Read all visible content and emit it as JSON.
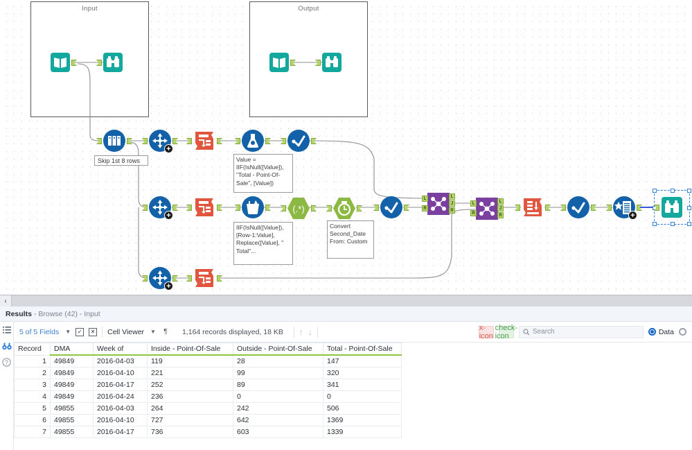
{
  "canvas": {
    "containers": [
      {
        "title": "Input"
      },
      {
        "title": "Output"
      }
    ],
    "annotations": [
      {
        "id": "skip",
        "text": "Skip 1st 8 rows"
      },
      {
        "id": "formula1",
        "text": "Value = IIF(IsNull([Value]), \"Total - Point-Of-Sale\", [Value])"
      },
      {
        "id": "multirow",
        "text": "IIF(IsNull([Value]), [Row-1:Value], Replace([Value], \" Total\"..."
      },
      {
        "id": "datetime",
        "text": "Convert Second_Date From: Custom"
      }
    ],
    "tools": [
      {
        "id": "input-1",
        "name": "input-data-tool",
        "icon": "book-icon",
        "color": "#13a89e"
      },
      {
        "id": "browse-1",
        "name": "browse-tool",
        "icon": "binoculars-icon",
        "color": "#13a89e"
      },
      {
        "id": "input-2",
        "name": "input-data-tool",
        "icon": "book-icon",
        "color": "#13a89e"
      },
      {
        "id": "browse-2",
        "name": "browse-tool",
        "icon": "binoculars-icon",
        "color": "#13a89e"
      },
      {
        "id": "sample-1",
        "name": "sample-tool",
        "icon": "sample-bars-icon",
        "color": "#1261a9"
      },
      {
        "id": "select-1",
        "name": "select-tool",
        "icon": "move-arrows-icon",
        "color": "#1261a9"
      },
      {
        "id": "transpose-1",
        "name": "transpose-tool",
        "icon": "transpose-icon",
        "color": "#e0563f"
      },
      {
        "id": "formula-1",
        "name": "formula-tool",
        "icon": "flask-icon",
        "color": "#1261a9"
      },
      {
        "id": "filter-1",
        "name": "filter-tool",
        "icon": "check-line-icon",
        "color": "#1261a9"
      },
      {
        "id": "select-2",
        "name": "select-tool",
        "icon": "move-arrows-icon",
        "color": "#1261a9"
      },
      {
        "id": "transpose-2",
        "name": "transpose-tool",
        "icon": "transpose-icon",
        "color": "#e0563f"
      },
      {
        "id": "multirow-1",
        "name": "multi-row-formula-tool",
        "icon": "bucket-icon",
        "color": "#1261a9"
      },
      {
        "id": "regex-1",
        "name": "regex-tool",
        "icon": "regex-icon",
        "color": "#8cb943"
      },
      {
        "id": "datetime-1",
        "name": "datetime-tool",
        "icon": "clock-icon",
        "color": "#8cb943"
      },
      {
        "id": "filter-2",
        "name": "filter-tool",
        "icon": "check-line-icon",
        "color": "#1261a9"
      },
      {
        "id": "select-3",
        "name": "select-tool",
        "icon": "move-arrows-icon",
        "color": "#1261a9"
      },
      {
        "id": "transpose-3",
        "name": "transpose-tool",
        "icon": "transpose-icon",
        "color": "#e0563f"
      },
      {
        "id": "join-1",
        "name": "join-tool",
        "icon": "join-icon",
        "color": "#7b3fa0"
      },
      {
        "id": "join-2",
        "name": "join-tool",
        "icon": "join-icon",
        "color": "#7b3fa0"
      },
      {
        "id": "crosstab-1",
        "name": "crosstab-tool",
        "icon": "crosstab-icon",
        "color": "#e0563f"
      },
      {
        "id": "filter-3",
        "name": "filter-tool",
        "icon": "check-line-icon",
        "color": "#1261a9"
      },
      {
        "id": "summarize-1",
        "name": "summarize-tool",
        "icon": "summarize-icon",
        "color": "#1261a9"
      },
      {
        "id": "browse-3",
        "name": "browse-tool-selected",
        "icon": "binoculars-icon",
        "color": "#13a89e"
      }
    ],
    "join_ports": [
      "L",
      "J",
      "R"
    ]
  },
  "splitter": {
    "collapse_icon": "chevron-left-icon"
  },
  "results": {
    "tab": {
      "title": "Results",
      "subtitle": "- Browse (42) - Input"
    },
    "rail": [
      {
        "name": "list-view-icon",
        "glyph": "☰"
      },
      {
        "name": "binoculars-icon",
        "glyph": "∞"
      },
      {
        "name": "help-icon",
        "glyph": "?"
      }
    ],
    "toolbar": {
      "fields_label": "5 of 5 Fields",
      "select_all_icon": "checkbox-check-icon",
      "deselect_all_icon": "checkbox-x-icon",
      "viewer_label": "Cell Viewer",
      "pilcrow_icon": "pilcrow-icon",
      "record_count": "1,164 records displayed, 18 KB",
      "up_arrow_icon": "arrow-up-icon",
      "down_arrow_icon": "arrow-down-icon",
      "cancel_icon": "x-icon",
      "confirm_icon": "check-icon",
      "search_icon": "search-icon",
      "search_placeholder": "Search",
      "search_value": "",
      "radio_data_label": "Data"
    },
    "table": {
      "columns": [
        "Record",
        "DMA",
        "Week of",
        "Inside - Point-Of-Sale",
        "Outside - Point-Of-Sale",
        "Total - Point-Of-Sale"
      ],
      "rows": [
        [
          "1",
          "49849",
          "2016-04-03",
          "119",
          "28",
          "147"
        ],
        [
          "2",
          "49849",
          "2016-04-10",
          "221",
          "99",
          "320"
        ],
        [
          "3",
          "49849",
          "2016-04-17",
          "252",
          "89",
          "341"
        ],
        [
          "4",
          "49849",
          "2016-04-24",
          "236",
          "0",
          "0"
        ],
        [
          "5",
          "49855",
          "2016-04-03",
          "264",
          "242",
          "506"
        ],
        [
          "6",
          "49855",
          "2016-04-10",
          "727",
          "642",
          "1369"
        ],
        [
          "7",
          "49855",
          "2016-04-17",
          "736",
          "603",
          "1339"
        ]
      ]
    }
  }
}
